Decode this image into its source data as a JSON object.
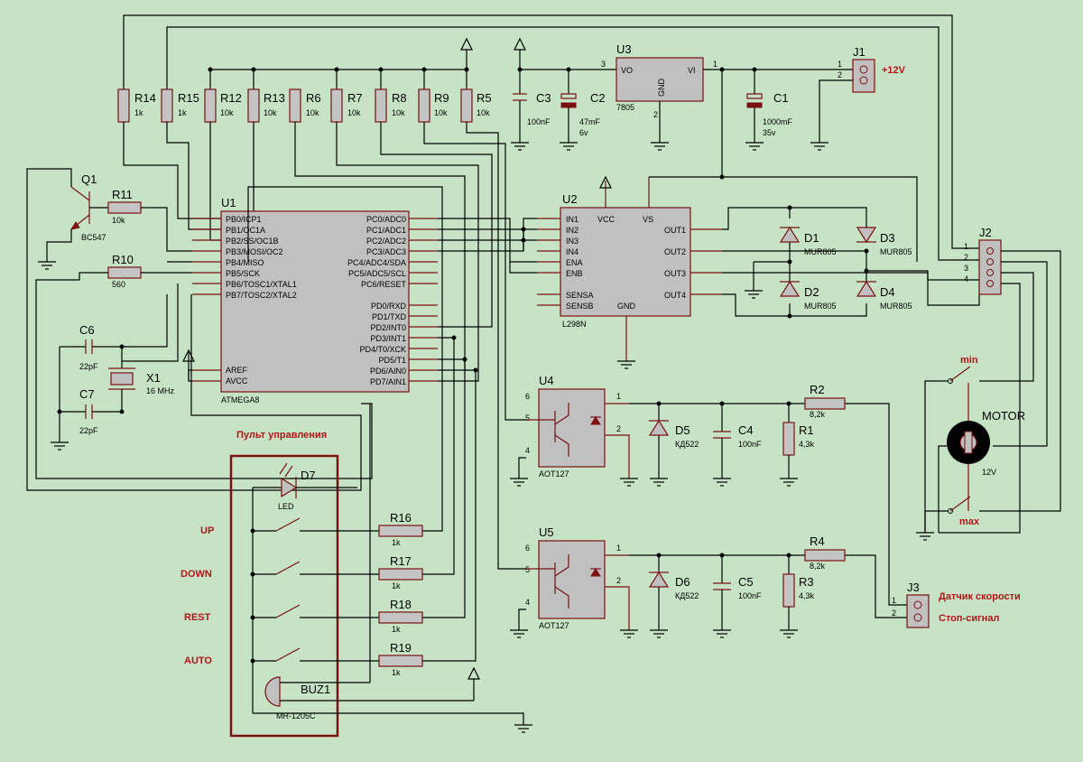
{
  "labels": {
    "supply": "+12V",
    "panel_title": "Пульт управления",
    "btn_up": "UP",
    "btn_down": "DOWN",
    "btn_rest": "REST",
    "btn_auto": "AUTO",
    "min": "min",
    "max": "max",
    "motor": "MOTOR",
    "motor_v": "12V",
    "speed_sensor": "Датчик скорости",
    "stop_signal": "Стоп-сигнал"
  },
  "resistors": {
    "R14": {
      "ref": "R14",
      "val": "1k"
    },
    "R15": {
      "ref": "R15",
      "val": "1k"
    },
    "R12": {
      "ref": "R12",
      "val": "10k"
    },
    "R13": {
      "ref": "R13",
      "val": "10k"
    },
    "R6": {
      "ref": "R6",
      "val": "10k"
    },
    "R7": {
      "ref": "R7",
      "val": "10k"
    },
    "R8": {
      "ref": "R8",
      "val": "10k"
    },
    "R9": {
      "ref": "R9",
      "val": "10k"
    },
    "R5": {
      "ref": "R5",
      "val": "10k"
    },
    "R11": {
      "ref": "R11",
      "val": "10k"
    },
    "R10": {
      "ref": "R10",
      "val": "560"
    },
    "R16": {
      "ref": "R16",
      "val": "1k"
    },
    "R17": {
      "ref": "R17",
      "val": "1k"
    },
    "R18": {
      "ref": "R18",
      "val": "1k"
    },
    "R19": {
      "ref": "R19",
      "val": "1k"
    },
    "R1": {
      "ref": "R1",
      "val": "4,3k"
    },
    "R2": {
      "ref": "R2",
      "val": "8,2k"
    },
    "R3": {
      "ref": "R3",
      "val": "4,3k"
    },
    "R4": {
      "ref": "R4",
      "val": "8,2k"
    }
  },
  "capacitors": {
    "C3": {
      "ref": "C3",
      "val": "100nF"
    },
    "C2": {
      "ref": "C2",
      "val": "47mF",
      "val2": "6v"
    },
    "C1": {
      "ref": "C1",
      "val": "1000mF",
      "val2": "35v"
    },
    "C6": {
      "ref": "C6",
      "val": "22pF"
    },
    "C7": {
      "ref": "C7",
      "val": "22pF"
    },
    "C4": {
      "ref": "C4",
      "val": "100nF"
    },
    "C5": {
      "ref": "C5",
      "val": "100nF"
    }
  },
  "diodes": {
    "D1": {
      "ref": "D1",
      "val": "MUR805"
    },
    "D2": {
      "ref": "D2",
      "val": "MUR805"
    },
    "D3": {
      "ref": "D3",
      "val": "MUR805"
    },
    "D4": {
      "ref": "D4",
      "val": "MUR805"
    },
    "D5": {
      "ref": "D5",
      "val": "КД522"
    },
    "D6": {
      "ref": "D6",
      "val": "КД522"
    },
    "D7": {
      "ref": "D7",
      "val": "LED"
    }
  },
  "parts": {
    "Q1": {
      "ref": "Q1",
      "val": "BC547"
    },
    "X1": {
      "ref": "X1",
      "val": "16 MHz"
    },
    "U3": {
      "ref": "U3",
      "val": "7805",
      "pin_vo": "VO",
      "pin_vi": "VI",
      "pin_gnd": "GND",
      "n3": "3",
      "n1": "1",
      "n2": "2"
    },
    "J1": {
      "ref": "J1",
      "n1": "1",
      "n2": "2"
    },
    "J2": {
      "ref": "J2",
      "n1": "1",
      "n2": "2",
      "n3": "3",
      "n4": "4"
    },
    "J3": {
      "ref": "J3",
      "n1": "1",
      "n2": "2"
    },
    "BUZ1": {
      "ref": "BUZ1",
      "val": "MR-1205C"
    },
    "U4": {
      "ref": "U4",
      "val": "AOT127",
      "n6": "6",
      "n5": "5",
      "n4": "4",
      "n1": "1",
      "n2": "2"
    },
    "U5": {
      "ref": "U5",
      "val": "AOT127",
      "n6": "6",
      "n5": "5",
      "n4": "4",
      "n1": "1",
      "n2": "2"
    }
  },
  "u1": {
    "ref": "U1",
    "val": "ATMEGA8",
    "left_pins": [
      "PB0/ICP1",
      "PB1/OC1A",
      "PB2/SS/OC1B",
      "PB3/MOSI/OC2",
      "PB4/MISO",
      "PB5/SCK",
      "PB6/TOSC1/XTAL1",
      "PB7/TOSC2/XTAL2"
    ],
    "left_pins2": [
      "AREF",
      "AVCC"
    ],
    "right_pins": [
      "PC0/ADC0",
      "PC1/ADC1",
      "PC2/ADC2",
      "PC3/ADC3",
      "PC4/ADC4/SDA",
      "PC5/ADC5/SCL",
      "PC6/RESET"
    ],
    "right_pins2": [
      "PD0/RXD",
      "PD1/TXD",
      "PD2/INT0",
      "PD3/INT1",
      "PD4/T0/XCK",
      "PD5/T1",
      "PD6/AIN0",
      "PD7/AIN1"
    ]
  },
  "u2": {
    "ref": "U2",
    "val": "L298N",
    "left_pins": [
      "IN1",
      "IN2",
      "IN3",
      "IN4",
      "ENA",
      "ENB"
    ],
    "left_pins2": [
      "SENSA",
      "SENSB"
    ],
    "top_pins": [
      "VCC",
      "VS"
    ],
    "bottom_pin": "GND",
    "right_pins": [
      "OUT1",
      "OUT2",
      "OUT3",
      "OUT4"
    ]
  }
}
